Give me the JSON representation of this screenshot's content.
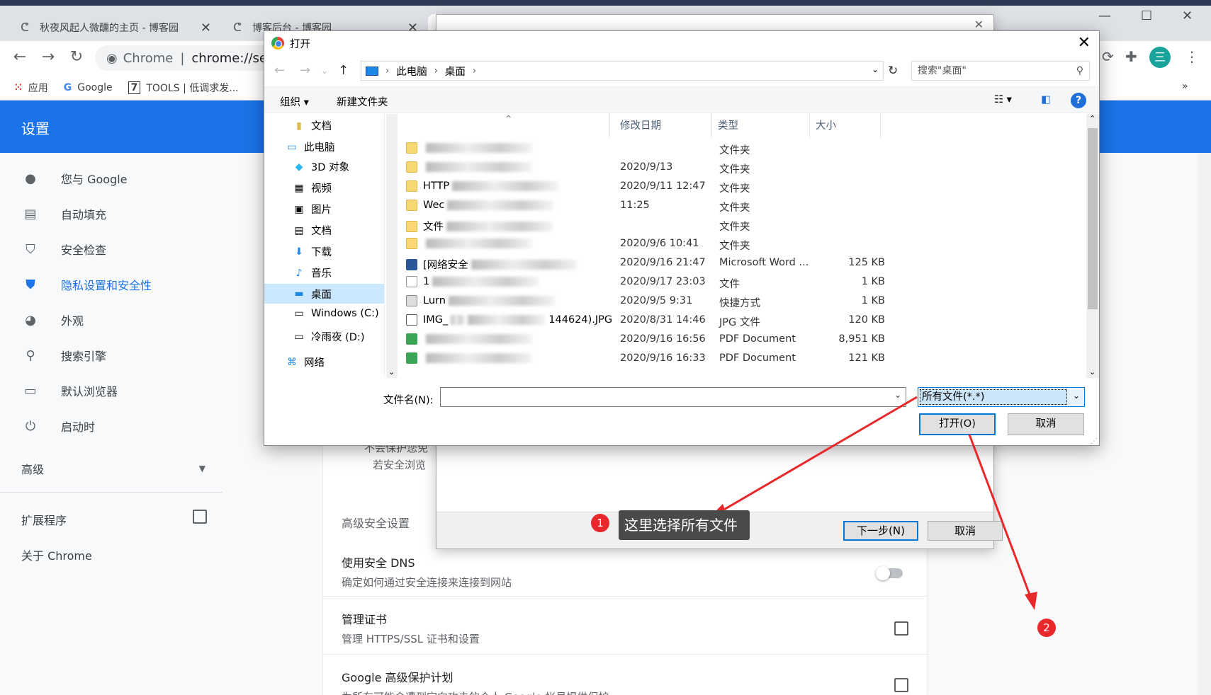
{
  "tabs": [
    {
      "title": "秋夜风起人微醺的主页 - 博客园"
    },
    {
      "title": "博客后台 - 博客园"
    }
  ],
  "toolbar": {
    "chip": "Chrome",
    "url": "chrome://set",
    "extension_badge": "0",
    "avatar_letter": "三"
  },
  "bookmarks": [
    {
      "label": "应用"
    },
    {
      "label": "Google"
    },
    {
      "label": "TOOLS | 低调求发..."
    }
  ],
  "settings": {
    "title": "设置",
    "sidebar": [
      {
        "label": "您与 Google"
      },
      {
        "label": "自动填充"
      },
      {
        "label": "安全检查"
      },
      {
        "label": "隐私设置和安全性"
      },
      {
        "label": "外观"
      },
      {
        "label": "搜索引擎"
      },
      {
        "label": "默认浏览器"
      },
      {
        "label": "启动时"
      }
    ],
    "advanced": "高级",
    "extensions": "扩展程序",
    "about": "关于 Chrome",
    "partial_text_1": "不会保护您免",
    "partial_text_2": "若安全浏览",
    "advanced_security": "高级安全设置",
    "dns_title": "使用安全 DNS",
    "dns_sub": "确定如何通过安全连接来连接到网站",
    "cert_title": "管理证书",
    "cert_sub": "管理 HTTPS/SSL 证书和设置",
    "gapp_title": "Google 高级保护计划",
    "gapp_sub": "为所有可能会遭到定向攻击的个人 Google 帐号提供保护"
  },
  "wizard": {
    "next": "下一步(N)",
    "cancel": "取消"
  },
  "dialog": {
    "title": "打开",
    "breadcrumb": [
      "此电脑",
      "桌面"
    ],
    "search_placeholder": "搜索\"桌面\"",
    "organize": "组织",
    "new_folder": "新建文件夹",
    "nav": [
      {
        "label": "文档",
        "icon": "folder-icon"
      },
      {
        "label": "此电脑",
        "icon": "pc-icon"
      },
      {
        "label": "3D 对象",
        "icon": "cube-icon"
      },
      {
        "label": "视频",
        "icon": "video-icon"
      },
      {
        "label": "图片",
        "icon": "picture-icon"
      },
      {
        "label": "文档",
        "icon": "document-icon"
      },
      {
        "label": "下载",
        "icon": "download-icon"
      },
      {
        "label": "音乐",
        "icon": "music-icon"
      },
      {
        "label": "桌面",
        "icon": "desktop-icon"
      },
      {
        "label": "Windows (C:)",
        "icon": "drive-icon"
      },
      {
        "label": "冷雨夜 (D:)",
        "icon": "drive-icon"
      },
      {
        "label": "网络",
        "icon": "network-icon"
      }
    ],
    "columns": {
      "name": "名称",
      "date": "修改日期",
      "type": "类型",
      "size": "大小"
    },
    "files": [
      {
        "name": "",
        "date": "",
        "type": "文件夹",
        "size": "",
        "icon": "folder"
      },
      {
        "name": "",
        "date": "2020/9/13",
        "type": "文件夹",
        "size": "",
        "icon": "folder"
      },
      {
        "name": "HTTP",
        "date": "2020/9/11 12:47",
        "type": "文件夹",
        "size": "",
        "icon": "folder"
      },
      {
        "name": "Wec",
        "date": "11:25",
        "type": "文件夹",
        "size": "",
        "icon": "folder"
      },
      {
        "name": "文件",
        "date": "",
        "type": "文件夹",
        "size": "",
        "icon": "folder"
      },
      {
        "name": "",
        "date": "2020/9/6 10:41",
        "type": "文件夹",
        "size": "",
        "icon": "folder"
      },
      {
        "name": "[网络安全",
        "date": "2020/9/16 21:47",
        "type": "Microsoft Word ...",
        "size": "125 KB",
        "icon": "word"
      },
      {
        "name": "1",
        "date": "2020/9/17 23:03",
        "type": "文件",
        "size": "1 KB",
        "icon": "file"
      },
      {
        "name": "Lurn",
        "date": "2020/9/5 9:31",
        "type": "快捷方式",
        "size": "1 KB",
        "icon": "lnk"
      },
      {
        "name": "IMG_",
        "name_tail": "144624).JPG",
        "date": "2020/8/31 14:46",
        "type": "JPG 文件",
        "size": "120 KB",
        "icon": "jpg"
      },
      {
        "name": "",
        "date": "2020/9/16 16:56",
        "type": "PDF Document",
        "size": "8,951 KB",
        "icon": "pdf"
      },
      {
        "name": "",
        "date": "2020/9/16 16:33",
        "type": "PDF Document",
        "size": "121 KB",
        "icon": "pdf"
      }
    ],
    "filename_label": "文件名(N):",
    "filename_value": "",
    "filter": "所有文件(*.*)",
    "open": "打开(O)",
    "cancel": "取消"
  },
  "annotations": {
    "marker1": "1",
    "marker2": "2",
    "tooltip": "这里选择所有文件",
    "color": "#e8282b"
  }
}
